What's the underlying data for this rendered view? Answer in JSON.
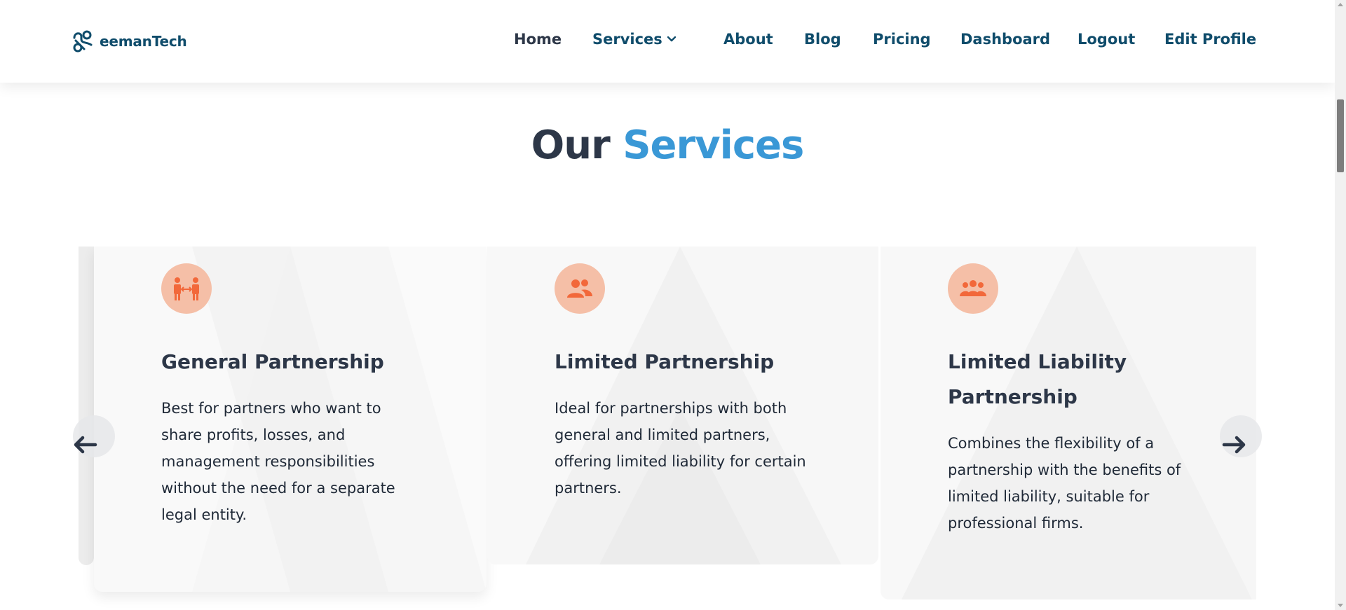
{
  "brand": {
    "name": "eemanTech",
    "icon": "link-nodes-logo-icon"
  },
  "nav": {
    "home": "Home",
    "services": "Services",
    "about": "About",
    "blog": "Blog",
    "pricing": "Pricing",
    "dashboard": "Dashboard",
    "logout": "Logout",
    "edit_profile": "Edit Profile"
  },
  "section": {
    "title_part1": "Our",
    "title_part2": "Services"
  },
  "cards": [
    {
      "icon": "partners-exchange-icon",
      "title": "General Partnership",
      "description": "Best for partners who want to share profits, losses, and management responsibilities without the need for a separate legal entity."
    },
    {
      "icon": "two-people-icon",
      "title": "Limited Partnership",
      "description": "Ideal for partnerships with both general and limited partners, offering limited liability for certain partners."
    },
    {
      "icon": "group-icon",
      "title": "Limited Liability Partnership",
      "description": "Combines the flexibility of a partnership with the benefits of limited liability, suitable for professional firms."
    }
  ],
  "colors": {
    "primary": "#0f4c6b",
    "accent": "#3a98d6",
    "icon_bg": "#f5bfa7",
    "icon_fg": "#f2683a",
    "heading": "#2d3748"
  }
}
